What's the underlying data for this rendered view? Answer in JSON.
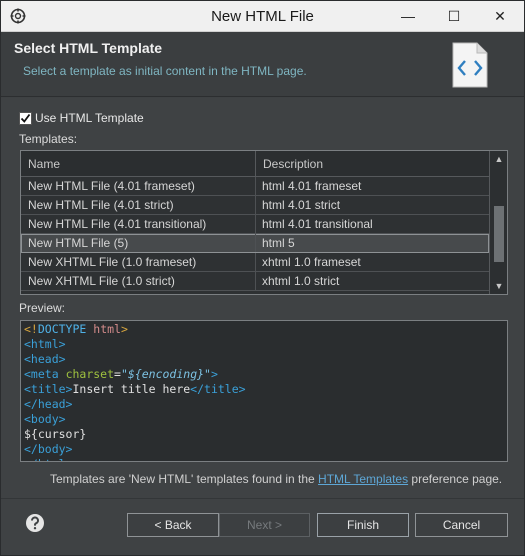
{
  "window": {
    "title": "New HTML File",
    "minimize_glyph": "—",
    "maximize_glyph": "☐",
    "close_glyph": "✕"
  },
  "banner": {
    "heading": "Select HTML Template",
    "subtext": "Select a template as initial content in the HTML page."
  },
  "options": {
    "use_template_label": "Use HTML Template",
    "use_template_checked": true,
    "templates_label": "Templates:"
  },
  "table": {
    "columns": [
      "Name",
      "Description"
    ],
    "rows": [
      {
        "name": "New HTML File (4.01 frameset)",
        "description": "html 4.01 frameset"
      },
      {
        "name": "New HTML File (4.01 strict)",
        "description": "html 4.01 strict"
      },
      {
        "name": "New HTML File (4.01 transitional)",
        "description": "html 4.01 transitional"
      },
      {
        "name": "New HTML File (5)",
        "description": "html 5"
      },
      {
        "name": "New XHTML File (1.0 frameset)",
        "description": "xhtml 1.0 frameset"
      },
      {
        "name": "New XHTML File (1.0 strict)",
        "description": "xhtml 1.0 strict"
      }
    ],
    "selected_index": 3
  },
  "preview": {
    "label": "Preview:",
    "lines": [
      "<!DOCTYPE html>",
      "<html>",
      "<head>",
      "<meta charset=\"${encoding}\">",
      "<title>Insert title here</title>",
      "</head>",
      "<body>",
      "${cursor}",
      "</body>",
      "</html>"
    ]
  },
  "footer": {
    "note_before": "Templates are 'New HTML' templates found in the ",
    "note_link": "HTML Templates",
    "note_after": " preference page."
  },
  "buttons": {
    "back": "< Back",
    "next": "Next >",
    "finish": "Finish",
    "cancel": "Cancel"
  },
  "colors": {
    "background": "#3f4244",
    "accent_link": "#5ea7d6",
    "tag_blue": "#3aa0d8",
    "attr_green": "#9fc23f"
  }
}
